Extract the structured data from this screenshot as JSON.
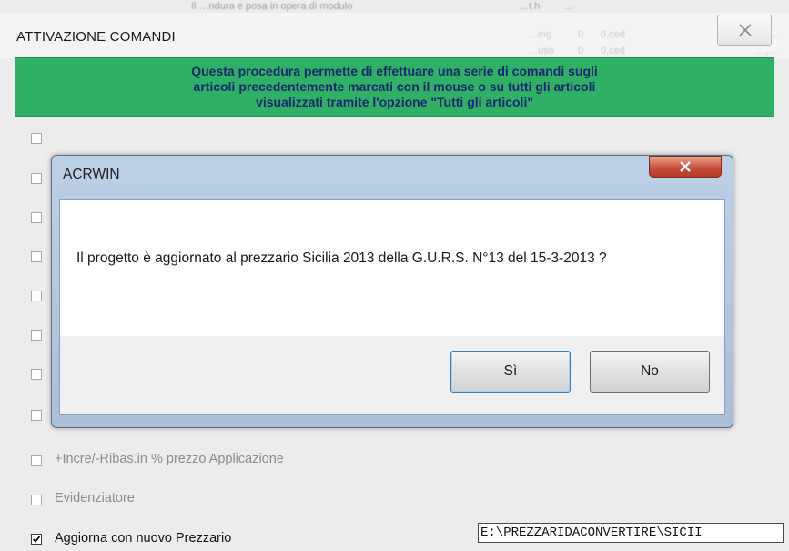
{
  "background_window": {
    "top_strip_fragments": [
      "Il …ndura e posa in opera di modulo",
      "…t.h",
      "…"
    ],
    "title": "ATTIVAZIONE COMANDI",
    "ghost_list_fragments": [
      "…mg",
      "0",
      "0,ced",
      "…,…",
      "…uso",
      "0",
      "0,ced",
      "…,…"
    ],
    "banner_lines": [
      "Questa procedura permette di effettuare una serie di comandi  sugli",
      "articoli  precedentemente marcati con il mouse  o su tutti gli articoli",
      "visualizzati tramite l'opzione \"Tutti gli articoli\""
    ],
    "checkbox_options": [
      {
        "label": "+Incre/-Ribas.in % prezzo Applicazione",
        "checked": false
      },
      {
        "label": "Evidenziatore",
        "checked": false
      },
      {
        "label": "Aggiorna con nuovo Prezzario",
        "checked": true
      }
    ],
    "path_field_value": "E:\\PREZZARIDACONVERTIRE\\SICII"
  },
  "dialog": {
    "title": "ACRWIN",
    "message": "Il progetto è aggiornato al prezzario Sicilia 2013 della G.U.R.S. N°13 del 15-3-2013 ?",
    "yes_label": "Sì",
    "no_label": "No",
    "close_icon": "close-x-icon"
  },
  "colors": {
    "banner_green": "#2fb064",
    "banner_text": "#17296e",
    "dialog_frame": "#b3c8dd",
    "close_red": "#c9513b"
  }
}
